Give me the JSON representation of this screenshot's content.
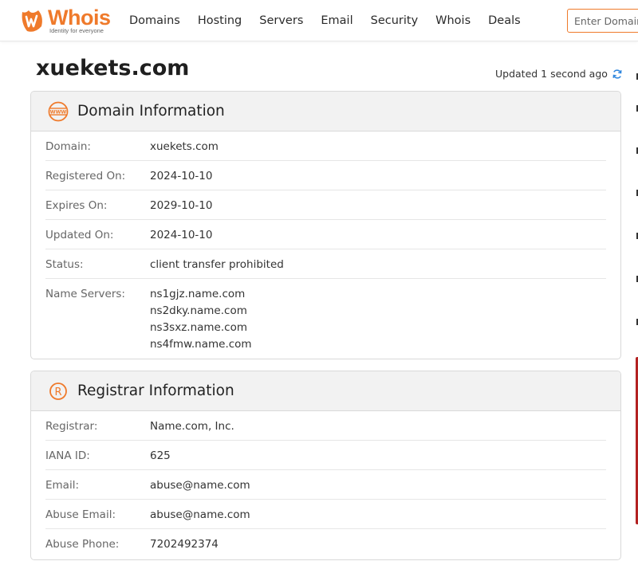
{
  "header": {
    "logo_text": "Whois",
    "logo_tagline": "Identity for everyone",
    "nav": [
      "Domains",
      "Hosting",
      "Servers",
      "Email",
      "Security",
      "Whois",
      "Deals"
    ],
    "search_placeholder": "Enter Domain"
  },
  "page": {
    "title": "xuekets.com",
    "updated_text": "Updated 1 second ago"
  },
  "domain_info": {
    "heading": "Domain Information",
    "rows": [
      {
        "label": "Domain:",
        "value": "xuekets.com"
      },
      {
        "label": "Registered On:",
        "value": "2024-10-10"
      },
      {
        "label": "Expires On:",
        "value": "2029-10-10"
      },
      {
        "label": "Updated On:",
        "value": "2024-10-10"
      },
      {
        "label": "Status:",
        "value": "client transfer prohibited"
      }
    ],
    "name_servers_label": "Name Servers:",
    "name_servers": [
      "ns1gjz.name.com",
      "ns2dky.name.com",
      "ns3sxz.name.com",
      "ns4fmw.name.com"
    ]
  },
  "registrar_info": {
    "heading": "Registrar Information",
    "rows": [
      {
        "label": "Registrar:",
        "value": "Name.com, Inc."
      },
      {
        "label": "IANA ID:",
        "value": "625"
      },
      {
        "label": "Email:",
        "value": "abuse@name.com"
      },
      {
        "label": "Abuse Email:",
        "value": "abuse@name.com"
      },
      {
        "label": "Abuse Phone:",
        "value": "7202492374"
      }
    ]
  },
  "colors": {
    "brand_orange": "#ef7a2b",
    "refresh_blue": "#2e86de",
    "panel_header_bg": "#f2f2f2",
    "side_banner_red": "#b32222"
  },
  "icons": {
    "logo": "whois-logo-icon",
    "refresh": "refresh-icon",
    "domain_panel": "www-globe-icon",
    "registrar_panel": "registered-r-icon"
  }
}
